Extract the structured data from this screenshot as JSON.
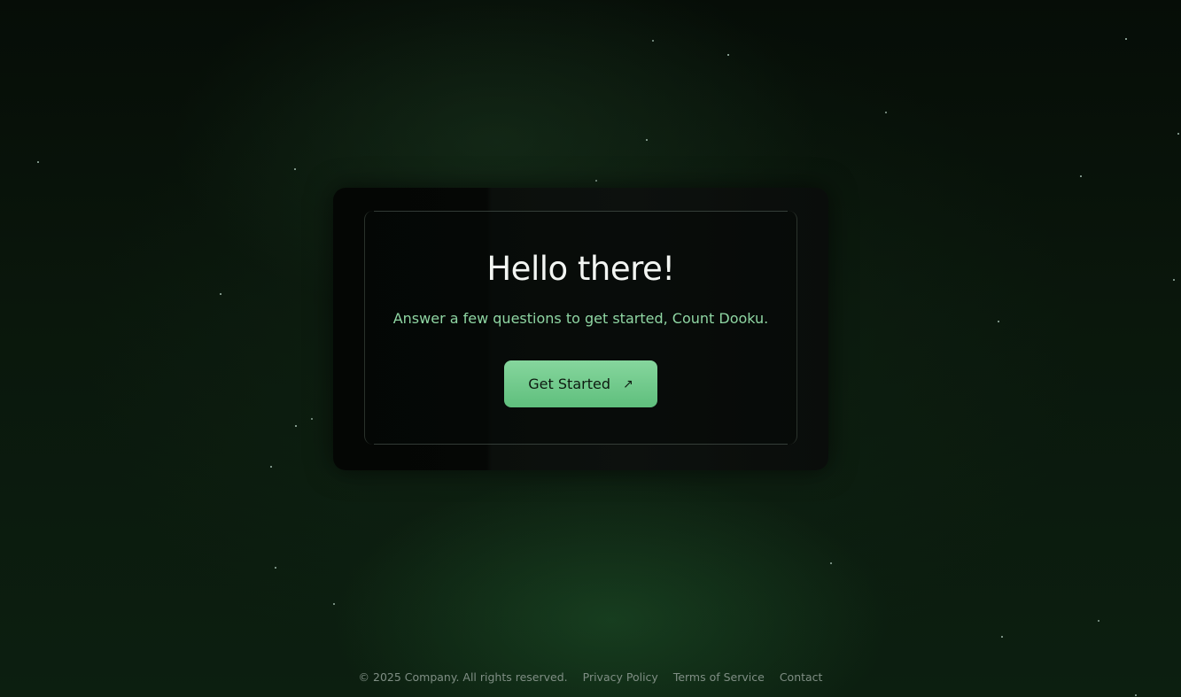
{
  "card": {
    "title": "Hello there!",
    "subtitle": "Answer a few questions to get started, Count Dooku.",
    "cta_label": "Get Started",
    "cta_icon": "arrow-up-right-icon",
    "cta_icon_glyph": "↗"
  },
  "footer": {
    "copyright": "© 2025 Company. All rights reserved.",
    "links": [
      "Privacy Policy",
      "Terms of Service",
      "Contact"
    ]
  },
  "colors": {
    "background": "#0a170c",
    "accent": "#6fca8b",
    "subtitle": "#8fd6a3",
    "title": "#f3f6f3",
    "footer_text": "#7f8e84"
  }
}
